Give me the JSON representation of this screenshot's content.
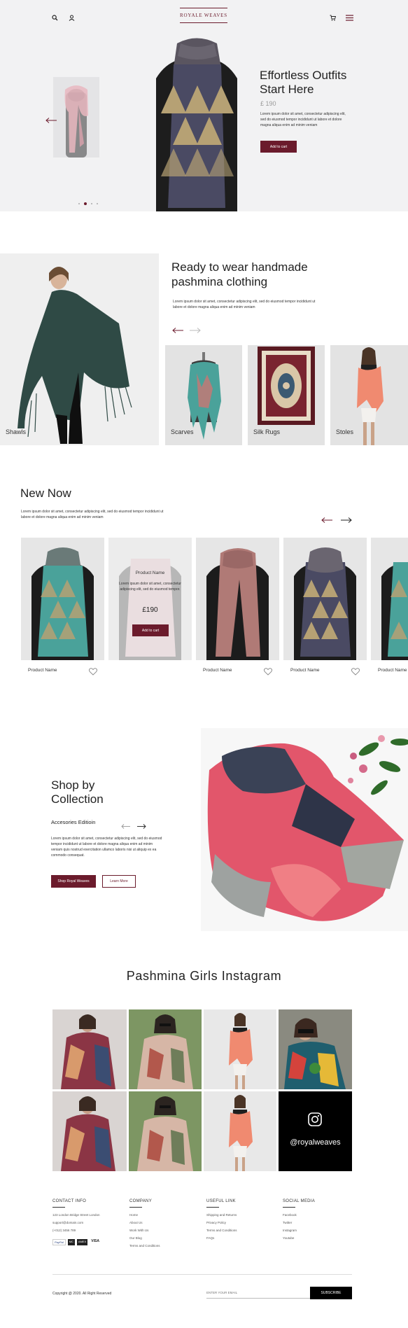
{
  "brand": {
    "logo_text": "ROYALE WEAVES"
  },
  "hero": {
    "title_line1": "Effortless Outfits",
    "title_line2": "Start Here",
    "price": "£ 190",
    "desc": "Lorem ipsum dolor sit amet, consectetur adipiscing elit, sed do eiusmod tempor incididunt ut labore et dolore magna aliqua enim ad minim veniam",
    "cta": "Add to cart"
  },
  "ready": {
    "title_line1": "Ready to wear handmade",
    "title_line2": "pashmina clothing",
    "desc": "Lorem ipsum dolor sit amet, consectetur adipiscing elit, sed do eiusmod tempor incididunt ut labore et dolore magna aliqua enim ad minim veniam",
    "categories": [
      "Shawls",
      "Scarves",
      "Silk Rugs",
      "Stoles"
    ]
  },
  "new_now": {
    "title": "New Now",
    "desc": "Lorem ipsum dolor sit amet, consectetur adipiscing elit, sed do eiusmod tempor incididunt ut labore et dolore magna aliqua enim ad minim veniam",
    "products": [
      {
        "name": "Product Name"
      },
      {
        "name": "Product Name",
        "hover_desc": "Lorem ipsum dolor sit amet, consectetur adipiscing elit, sed do eiusmod tempor.",
        "price": "£190",
        "cta": "Add to cart"
      },
      {
        "name": "Product Name"
      },
      {
        "name": "Product Name"
      },
      {
        "name": "Product Name"
      }
    ]
  },
  "collection": {
    "title_line1": "Shop by",
    "title_line2": "Collection",
    "subtitle": "Accesories Editioin",
    "desc": "Lorem ipsum dolor sit amet, consectetur adipiscing elit, sed do eiusmod tempor incididunt ut labore et dolore magna aliqua enim ad minim veniam quis nostrud exercitation ullamco laboris nisi ut aliquip ex ea commodo consequat.",
    "btn_primary": "Shop Royal Weaves",
    "btn_secondary": "Learn More"
  },
  "instagram": {
    "title": "Pashmina Girls Instagram",
    "handle": "@royalweaves"
  },
  "footer": {
    "contact": {
      "heading": "CONTACT INFO",
      "address": "123 London Bridge Street London",
      "email": "support@domain.com",
      "phone": "(+012) 3456 789"
    },
    "company": {
      "heading": "COMPANY",
      "links": [
        "Home",
        "About Us",
        "Work With Us",
        "Our Blog",
        "Terms and Conditions"
      ]
    },
    "useful": {
      "heading": "USEFUL LINK",
      "links": [
        "Shipping and Returns",
        "Privacy Policy",
        "Terms and Conditions",
        "FAQs"
      ]
    },
    "social": {
      "heading": "SOCIAL MEDIA",
      "links": [
        "Facebook",
        "Twitter",
        "Instagram",
        "Youtube"
      ]
    },
    "payments": [
      "PayPal",
      "MC",
      "AMEX",
      "VISA"
    ],
    "copyright": "Copyright @ 2020. All Right Reserved",
    "email_placeholder": "ENTER YOUR EMAIL",
    "subscribe": "SUBSCRIBE"
  },
  "colors": {
    "accent": "#6b1b2c",
    "hero_bg": "#f2f2f3",
    "tile_bg": "#e6e6e6"
  }
}
